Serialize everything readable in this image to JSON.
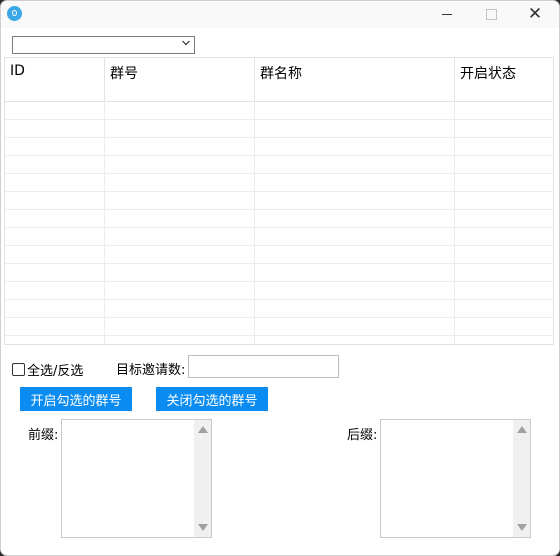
{
  "window": {
    "app_icon": "app-logo-icon",
    "controls": {
      "minimize": "minimize-icon",
      "maximize": "maximize-icon",
      "close": "close-icon"
    },
    "close_glyph": "✕"
  },
  "filter_combo": {
    "value": ""
  },
  "grid": {
    "columns": [
      "ID",
      "群号",
      "群名称",
      "开启状态"
    ],
    "rows": []
  },
  "select_all_label": "全选/反选",
  "target_invites_label": "目标邀请数:",
  "target_invites_value": "",
  "enable_button_label": "开启勾选的群号",
  "disable_button_label": "关闭勾选的群号",
  "prefix_label": "前缀:",
  "suffix_label": "后缀:",
  "prefix_value": "",
  "suffix_value": "",
  "colors": {
    "accent": "#0a8cf2"
  }
}
